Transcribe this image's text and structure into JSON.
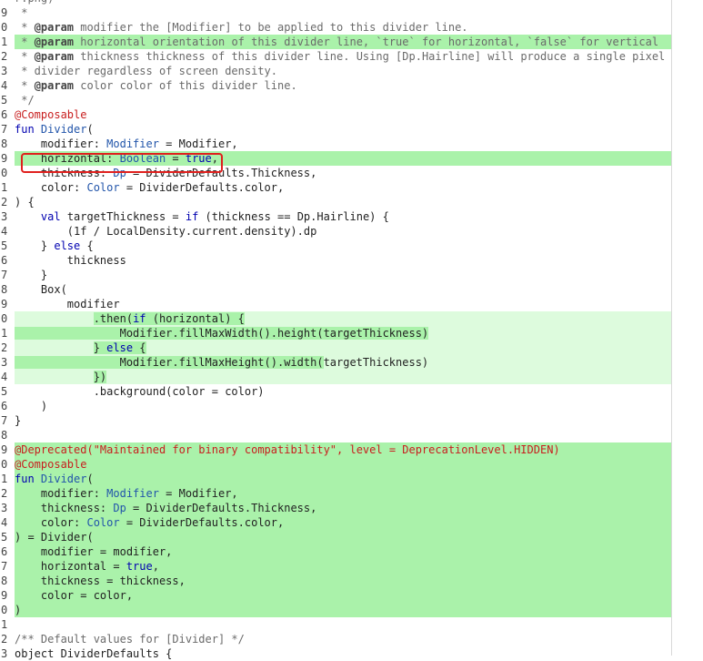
{
  "code_view": {
    "lines": [
      {
        "num": "",
        "style": "plain",
        "segments": [
          {
            "t": "r.png)",
            "c": "c"
          }
        ]
      },
      {
        "num": "9",
        "style": "plain",
        "segments": [
          {
            "t": " *",
            "c": "c"
          }
        ]
      },
      {
        "num": "0",
        "style": "plain",
        "segments": [
          {
            "t": " * ",
            "c": "c"
          },
          {
            "t": "@param",
            "c": "tag"
          },
          {
            "t": " modifier the [Modifier] to be applied to this divider line.",
            "c": "c"
          }
        ]
      },
      {
        "num": "1",
        "style": "hl",
        "segments": [
          {
            "t": " * ",
            "c": "c"
          },
          {
            "t": "@param",
            "c": "tag"
          },
          {
            "t": " horizontal orientation of this divider line, `true` for horizontal, `false` for vertical",
            "c": "c"
          }
        ]
      },
      {
        "num": "2",
        "style": "plain",
        "segments": [
          {
            "t": " * ",
            "c": "c"
          },
          {
            "t": "@param",
            "c": "tag"
          },
          {
            "t": " thickness thickness of this divider line. Using [Dp.Hairline] will produce a single pixel",
            "c": "c"
          }
        ]
      },
      {
        "num": "3",
        "style": "plain",
        "segments": [
          {
            "t": " * divider regardless of screen density.",
            "c": "c"
          }
        ]
      },
      {
        "num": "4",
        "style": "plain",
        "segments": [
          {
            "t": " * ",
            "c": "c"
          },
          {
            "t": "@param",
            "c": "tag"
          },
          {
            "t": " color color of this divider line.",
            "c": "c"
          }
        ]
      },
      {
        "num": "5",
        "style": "plain",
        "segments": [
          {
            "t": " */",
            "c": "c"
          }
        ]
      },
      {
        "num": "6",
        "style": "plain",
        "segments": [
          {
            "t": "@Composable",
            "c": "a"
          }
        ]
      },
      {
        "num": "7",
        "style": "plain",
        "segments": [
          {
            "t": "fun ",
            "c": "k"
          },
          {
            "t": "Divider",
            "c": "t"
          },
          {
            "t": "(",
            "c": "n"
          }
        ]
      },
      {
        "num": "8",
        "style": "plain",
        "segments": [
          {
            "t": "    modifier: ",
            "c": "n"
          },
          {
            "t": "Modifier",
            "c": "t"
          },
          {
            "t": " = Modifier,",
            "c": "n"
          }
        ]
      },
      {
        "num": "9",
        "style": "hl",
        "segments": [
          {
            "t": "    horizontal: ",
            "c": "n"
          },
          {
            "t": "Boolean",
            "c": "t"
          },
          {
            "t": " = ",
            "c": "n"
          },
          {
            "t": "true",
            "c": "k"
          },
          {
            "t": ",",
            "c": "n"
          }
        ]
      },
      {
        "num": "0",
        "style": "plain",
        "segments": [
          {
            "t": "    thickness: ",
            "c": "n"
          },
          {
            "t": "Dp",
            "c": "t"
          },
          {
            "t": " = DividerDefaults.Thickness,",
            "c": "n"
          }
        ]
      },
      {
        "num": "1",
        "style": "plain",
        "segments": [
          {
            "t": "    color: ",
            "c": "n"
          },
          {
            "t": "Color",
            "c": "t"
          },
          {
            "t": " = DividerDefaults.color,",
            "c": "n"
          }
        ]
      },
      {
        "num": "2",
        "style": "plain",
        "segments": [
          {
            "t": ") {",
            "c": "n"
          }
        ]
      },
      {
        "num": "3",
        "style": "plain",
        "segments": [
          {
            "t": "    ",
            "c": "n"
          },
          {
            "t": "val",
            "c": "k"
          },
          {
            "t": " targetThickness = ",
            "c": "n"
          },
          {
            "t": "if",
            "c": "k"
          },
          {
            "t": " (thickness == Dp.Hairline) {",
            "c": "n"
          }
        ]
      },
      {
        "num": "4",
        "style": "plain",
        "segments": [
          {
            "t": "        (1f / LocalDensity.current.density).dp",
            "c": "n"
          }
        ]
      },
      {
        "num": "5",
        "style": "plain",
        "segments": [
          {
            "t": "    } ",
            "c": "n"
          },
          {
            "t": "else",
            "c": "k"
          },
          {
            "t": " {",
            "c": "n"
          }
        ]
      },
      {
        "num": "6",
        "style": "plain",
        "segments": [
          {
            "t": "        thickness",
            "c": "n"
          }
        ]
      },
      {
        "num": "7",
        "style": "plain",
        "segments": [
          {
            "t": "    }",
            "c": "n"
          }
        ]
      },
      {
        "num": "8",
        "style": "plain",
        "segments": [
          {
            "t": "    Box(",
            "c": "n"
          }
        ]
      },
      {
        "num": "9",
        "style": "plain",
        "segments": [
          {
            "t": "        modifier",
            "c": "n"
          }
        ]
      },
      {
        "num": "0",
        "style": "light",
        "segments": [
          {
            "t": "            ",
            "c": "n"
          },
          {
            "t": ".then(",
            "c": "n",
            "hl": true
          },
          {
            "t": "if",
            "c": "k",
            "hl": true
          },
          {
            "t": " (horizontal) {",
            "c": "n",
            "hl": true
          }
        ]
      },
      {
        "num": "1",
        "style": "light",
        "segments": [
          {
            "t": "                Modifier.fillMaxWidth()",
            "c": "n",
            "hl": true
          },
          {
            "t": ".height(targetThickness)",
            "c": "n",
            "hl": true
          }
        ]
      },
      {
        "num": "2",
        "style": "light",
        "segments": [
          {
            "t": "            ",
            "c": "n"
          },
          {
            "t": "} ",
            "c": "n",
            "hl": true
          },
          {
            "t": "else",
            "c": "k",
            "hl": true
          },
          {
            "t": " {",
            "c": "n",
            "hl": true
          }
        ]
      },
      {
        "num": "3",
        "style": "light",
        "segments": [
          {
            "t": "                Modifier.fillMaxHeight()",
            "c": "n",
            "hl": true
          },
          {
            "t": ".width(",
            "c": "n",
            "hl": true
          },
          {
            "t": "targetThickness)",
            "c": "n"
          }
        ]
      },
      {
        "num": "4",
        "style": "light",
        "segments": [
          {
            "t": "            ",
            "c": "n"
          },
          {
            "t": "})",
            "c": "n",
            "hl": true
          }
        ]
      },
      {
        "num": "5",
        "style": "plain",
        "segments": [
          {
            "t": "            .background(color = color)",
            "c": "n"
          }
        ]
      },
      {
        "num": "6",
        "style": "plain",
        "segments": [
          {
            "t": "    )",
            "c": "n"
          }
        ]
      },
      {
        "num": "7",
        "style": "plain",
        "segments": [
          {
            "t": "}",
            "c": "n"
          }
        ]
      },
      {
        "num": "8",
        "style": "plain",
        "segments": [
          {
            "t": "",
            "c": "n"
          }
        ]
      },
      {
        "num": "9",
        "style": "hl",
        "segments": [
          {
            "t": "@Deprecated(",
            "c": "a"
          },
          {
            "t": "\"Maintained for binary compatibility\"",
            "c": "s"
          },
          {
            "t": ", level = DeprecationLevel.HIDDEN)",
            "c": "a"
          }
        ]
      },
      {
        "num": "0",
        "style": "hl",
        "segments": [
          {
            "t": "@Composable",
            "c": "a"
          }
        ]
      },
      {
        "num": "1",
        "style": "hl",
        "segments": [
          {
            "t": "fun ",
            "c": "k"
          },
          {
            "t": "Divider",
            "c": "t"
          },
          {
            "t": "(",
            "c": "n"
          }
        ]
      },
      {
        "num": "2",
        "style": "hl",
        "segments": [
          {
            "t": "    modifier: ",
            "c": "n"
          },
          {
            "t": "Modifier",
            "c": "t"
          },
          {
            "t": " = Modifier,",
            "c": "n"
          }
        ]
      },
      {
        "num": "3",
        "style": "hl",
        "segments": [
          {
            "t": "    thickness: ",
            "c": "n"
          },
          {
            "t": "Dp",
            "c": "t"
          },
          {
            "t": " = DividerDefaults.Thickness,",
            "c": "n"
          }
        ]
      },
      {
        "num": "4",
        "style": "hl",
        "segments": [
          {
            "t": "    color: ",
            "c": "n"
          },
          {
            "t": "Color",
            "c": "t"
          },
          {
            "t": " = DividerDefaults.color,",
            "c": "n"
          }
        ]
      },
      {
        "num": "5",
        "style": "hl",
        "segments": [
          {
            "t": ") = Divider(",
            "c": "n"
          }
        ]
      },
      {
        "num": "6",
        "style": "hl",
        "segments": [
          {
            "t": "    modifier = modifier,",
            "c": "n"
          }
        ]
      },
      {
        "num": "7",
        "style": "hl",
        "segments": [
          {
            "t": "    horizontal = ",
            "c": "n"
          },
          {
            "t": "true",
            "c": "k"
          },
          {
            "t": ",",
            "c": "n"
          }
        ]
      },
      {
        "num": "8",
        "style": "hl",
        "segments": [
          {
            "t": "    thickness = thickness,",
            "c": "n"
          }
        ]
      },
      {
        "num": "9",
        "style": "hl",
        "segments": [
          {
            "t": "    color = color,",
            "c": "n"
          }
        ]
      },
      {
        "num": "0",
        "style": "hl",
        "segments": [
          {
            "t": ")",
            "c": "n"
          }
        ]
      },
      {
        "num": "1",
        "style": "plain",
        "segments": [
          {
            "t": "",
            "c": "n"
          }
        ]
      },
      {
        "num": "2",
        "style": "plain",
        "segments": [
          {
            "t": "/** Default values for [Divider] */",
            "c": "c"
          }
        ]
      },
      {
        "num": "3",
        "style": "plain",
        "segments": [
          {
            "t": "object DividerDefaults {",
            "c": "n"
          }
        ]
      }
    ]
  },
  "colors": {
    "added_line_bg": "#aaf2aa",
    "changed_line_bg": "#ddfbdd",
    "annotation_box": "#e0201e"
  }
}
